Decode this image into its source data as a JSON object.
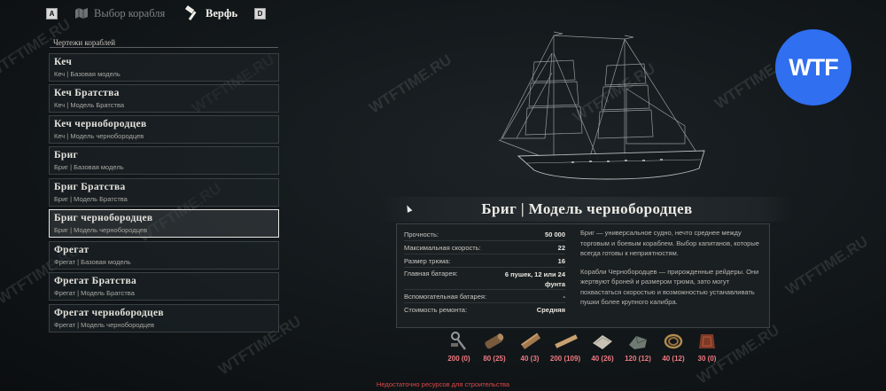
{
  "topbar": {
    "left_key": "A",
    "tab_select_label": "Выбор корабля",
    "tab_shipyard_label": "Верфь",
    "right_key": "D"
  },
  "blueprints": {
    "title": "Чертежи кораблей",
    "items": [
      {
        "name": "Кеч",
        "sub": "Кеч | Базовая модель"
      },
      {
        "name": "Кеч Братства",
        "sub": "Кеч | Модель Братства"
      },
      {
        "name": "Кеч чернобородцев",
        "sub": "Кеч | Модель чернобородцев"
      },
      {
        "name": "Бриг",
        "sub": "Бриг | Базовая модель"
      },
      {
        "name": "Бриг Братства",
        "sub": "Бриг | Модель Братства"
      },
      {
        "name": "Бриг чернобородцев",
        "sub": "Бриг | Модель чернобородцев"
      },
      {
        "name": "Фрегат",
        "sub": "Фрегат | Базовая модель"
      },
      {
        "name": "Фрегат Братства",
        "sub": "Фрегат | Модель Братства"
      },
      {
        "name": "Фрегат чернобородцев",
        "sub": "Фрегат | Модель чернобородцев"
      }
    ],
    "selected_index": 5
  },
  "detail": {
    "title": "Бриг | Модель чернобородцев",
    "stats": [
      {
        "label": "Прочность:",
        "value": "50 000"
      },
      {
        "label": "Максимальная скорость:",
        "value": "22"
      },
      {
        "label": "Размер трюма:",
        "value": "16"
      },
      {
        "label": "Главная батарея:",
        "value": "6 пушек, 12 или 24 фунта"
      },
      {
        "label": "Вспомогательная батарея:",
        "value": "-"
      },
      {
        "label": "Стоимость ремонта:",
        "value": "Средняя"
      }
    ],
    "description_1": "Бриг — универсальное судно, нечто среднее между торговым и боевым кораблем. Выбор капитанов, которые всегда готовы к неприятностям.",
    "description_2": "Корабли Чернобородцев — прирожденные рейдеры. Они жертвуют броней и размером трюма, зато могут похвастаться скоростью и возможностью устанавливать пушки более крупного калибра."
  },
  "resources": [
    {
      "icon": "tools-icon",
      "count": "200 (0)"
    },
    {
      "icon": "logs-icon",
      "count": "80 (25)"
    },
    {
      "icon": "beam-icon",
      "count": "40 (3)"
    },
    {
      "icon": "plank-icon",
      "count": "200 (109)"
    },
    {
      "icon": "cloth-icon",
      "count": "40 (26)"
    },
    {
      "icon": "ore-icon",
      "count": "120 (12)"
    },
    {
      "icon": "rope-icon",
      "count": "40 (12)"
    },
    {
      "icon": "leather-icon",
      "count": "30 (0)"
    }
  ],
  "warning": "Недостаточно ресурсов для строительства",
  "logo": {
    "text": "WTF",
    "color": "#2f6ff0"
  },
  "watermark_text": "WTFTIME.RU",
  "colors": {
    "resource_count": "#f07a82",
    "warning": "#e04848"
  }
}
